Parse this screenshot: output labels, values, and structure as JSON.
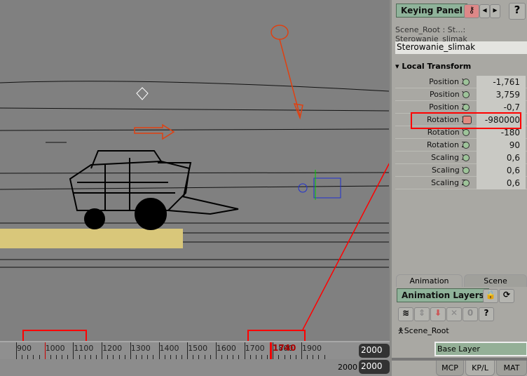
{
  "panel": {
    "title": "Keying Panel",
    "breadcrumb": "Scene_Root : St...: Sterowanie_slimak",
    "object_name": "Sterowanie_slimak",
    "section": "Local Transform",
    "properties": [
      {
        "label": "Position X",
        "value": "-1,761",
        "keyed": false
      },
      {
        "label": "Position Y",
        "value": "3,759",
        "keyed": false
      },
      {
        "label": "Position Z",
        "value": "-0,7",
        "keyed": false
      },
      {
        "label": "Rotation X",
        "value": "-980000",
        "keyed": true
      },
      {
        "label": "Rotation Y",
        "value": "-180",
        "keyed": false
      },
      {
        "label": "Rotation Z",
        "value": "90",
        "keyed": false
      },
      {
        "label": "Scaling X",
        "value": "0,6",
        "keyed": false
      },
      {
        "label": "Scaling Y",
        "value": "0,6",
        "keyed": false
      },
      {
        "label": "Scaling Z",
        "value": "0,6",
        "keyed": false
      }
    ],
    "tabs": [
      "Animation",
      "Scene"
    ],
    "anim_layers_label": "Animation Layers",
    "scene_root": "Scene_Root",
    "base_layer": "Base Layer",
    "bottom_tabs": [
      "MCP",
      "KP/L",
      "MAT"
    ],
    "help": "?"
  },
  "timeline": {
    "ticks": [
      "900",
      "1000",
      "1100",
      "1200",
      "1300",
      "1400",
      "1500",
      "1600",
      "1700",
      "1800",
      "1900"
    ],
    "current_frame": "1740",
    "end_frame": "2000",
    "end_frame_2": "2000",
    "end_frame_3": "2000"
  },
  "colors": {
    "accent_green": "#8fb39a",
    "highlight": "#ff0000",
    "key_active": "#e08a80"
  }
}
